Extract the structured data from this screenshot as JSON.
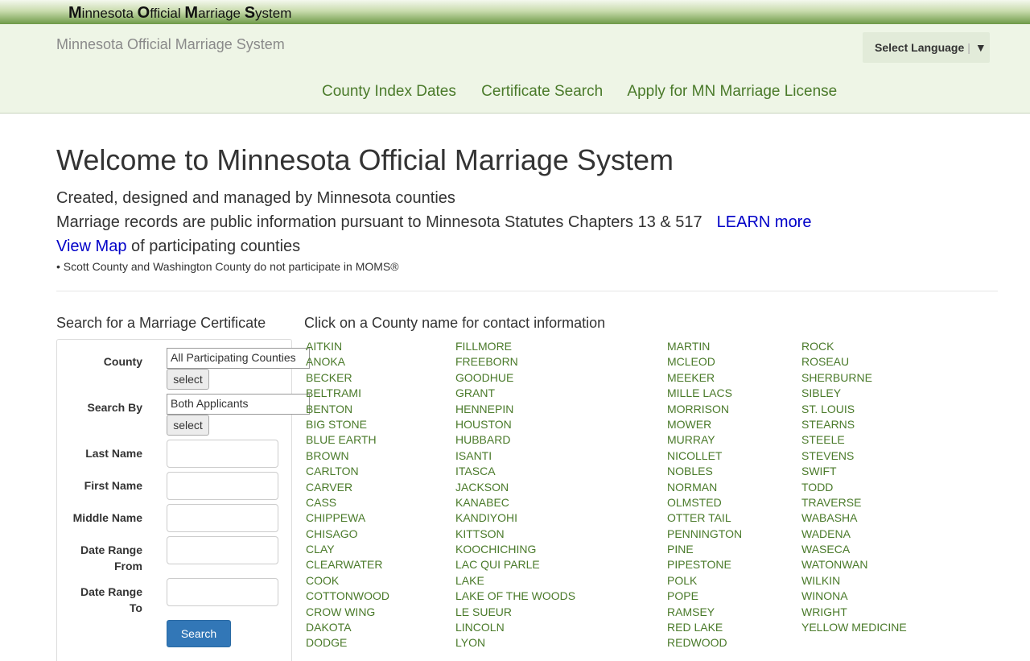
{
  "topbar": {
    "title_parts": [
      [
        "M",
        "innesota "
      ],
      [
        "O",
        "fficial "
      ],
      [
        "M",
        "arriage "
      ],
      [
        "S",
        "ystem"
      ]
    ]
  },
  "header": {
    "logo_alt": "Minnesota Official Marriage System",
    "language": {
      "label": "Select Language",
      "arrow": "▼"
    },
    "nav": [
      "County Index Dates",
      "Certificate Search",
      "Apply for MN Marriage License"
    ]
  },
  "intro": {
    "title": "Welcome to Minnesota Official Marriage System",
    "line1": "Created, designed and managed by Minnesota counties",
    "line2": "Marriage records are public information pursuant to Minnesota Statutes Chapters 13 & 517",
    "learn_more": "LEARN more",
    "view_map": "View Map",
    "view_map_suffix": " of participating counties",
    "note": "• Scott County and Washington County do not participate in MOMS®"
  },
  "search_form": {
    "heading": "Search for a Marriage Certificate",
    "county_label": "County",
    "county_value": "All Participating Counties",
    "select_label": "select",
    "search_by_label": "Search By",
    "search_by_value": "Both Applicants",
    "last_name_label": "Last Name",
    "first_name_label": "First Name",
    "middle_name_label": "Middle Name",
    "date_from_label_1": "Date Range",
    "date_from_label_2": "From",
    "date_to_label_1": "Date Range",
    "date_to_label_2": "To",
    "search_button": "Search"
  },
  "counties": {
    "heading": "Click on a County name for contact information",
    "columns": [
      [
        "AITKIN",
        "ANOKA",
        "BECKER",
        "BELTRAMI",
        "BENTON",
        "BIG STONE",
        "BLUE EARTH",
        "BROWN",
        "CARLTON",
        "CARVER",
        "CASS",
        "CHIPPEWA",
        "CHISAGO",
        "CLAY",
        "CLEARWATER",
        "COOK",
        "COTTONWOOD",
        "CROW WING",
        "DAKOTA",
        "DODGE"
      ],
      [
        "FILLMORE",
        "FREEBORN",
        "GOODHUE",
        "GRANT",
        "HENNEPIN",
        "HOUSTON",
        "HUBBARD",
        "ISANTI",
        "ITASCA",
        "JACKSON",
        "KANABEC",
        "KANDIYOHI",
        "KITTSON",
        "KOOCHICHING",
        "LAC QUI PARLE",
        "LAKE",
        "LAKE OF THE WOODS",
        "LE SUEUR",
        "LINCOLN",
        "LYON"
      ],
      [
        "MARTIN",
        "MCLEOD",
        "MEEKER",
        "MILLE LACS",
        "MORRISON",
        "MOWER",
        "MURRAY",
        "NICOLLET",
        "NOBLES",
        "NORMAN",
        "OLMSTED",
        "OTTER TAIL",
        "PENNINGTON",
        "PINE",
        "PIPESTONE",
        "POLK",
        "POPE",
        "RAMSEY",
        "RED LAKE",
        "REDWOOD"
      ],
      [
        "ROCK",
        "ROSEAU",
        "SHERBURNE",
        "SIBLEY",
        "ST. LOUIS",
        "STEARNS",
        "STEELE",
        "STEVENS",
        "SWIFT",
        "TODD",
        "TRAVERSE",
        "WABASHA",
        "WADENA",
        "WASECA",
        "WATONWAN",
        "WILKIN",
        "WINONA",
        "WRIGHT",
        "YELLOW MEDICINE"
      ]
    ]
  }
}
